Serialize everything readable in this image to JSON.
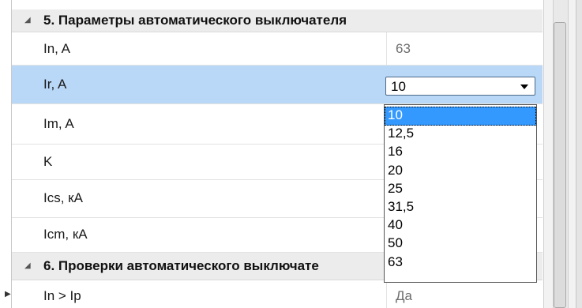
{
  "categories": [
    {
      "glyph": "◢",
      "title": "5. Параметры автоматического выключателя"
    },
    {
      "glyph": "◢",
      "title": "6. Проверки автоматического выключате"
    }
  ],
  "properties": [
    {
      "name": "In, A",
      "value": "63"
    },
    {
      "name": "Ir, A",
      "value": "10"
    },
    {
      "name": "Im, A",
      "value": ""
    },
    {
      "name": "K",
      "value": ""
    },
    {
      "name": "Ics, кА",
      "value": ""
    },
    {
      "name": "Icm, кА",
      "value": ""
    }
  ],
  "check_row": {
    "expander": "▶",
    "name": "In > Ip",
    "value": "Да"
  },
  "combo": {
    "selected": "10",
    "icon": "chevron-down-icon"
  },
  "dropdown": {
    "options": [
      "10",
      "12,5",
      "16",
      "20",
      "25",
      "31,5",
      "40",
      "50",
      "63"
    ],
    "highlighted": "10"
  },
  "colors": {
    "selected_row": "#b9d7f6",
    "highlight": "#3399ff",
    "category_bg": "#ececec"
  }
}
